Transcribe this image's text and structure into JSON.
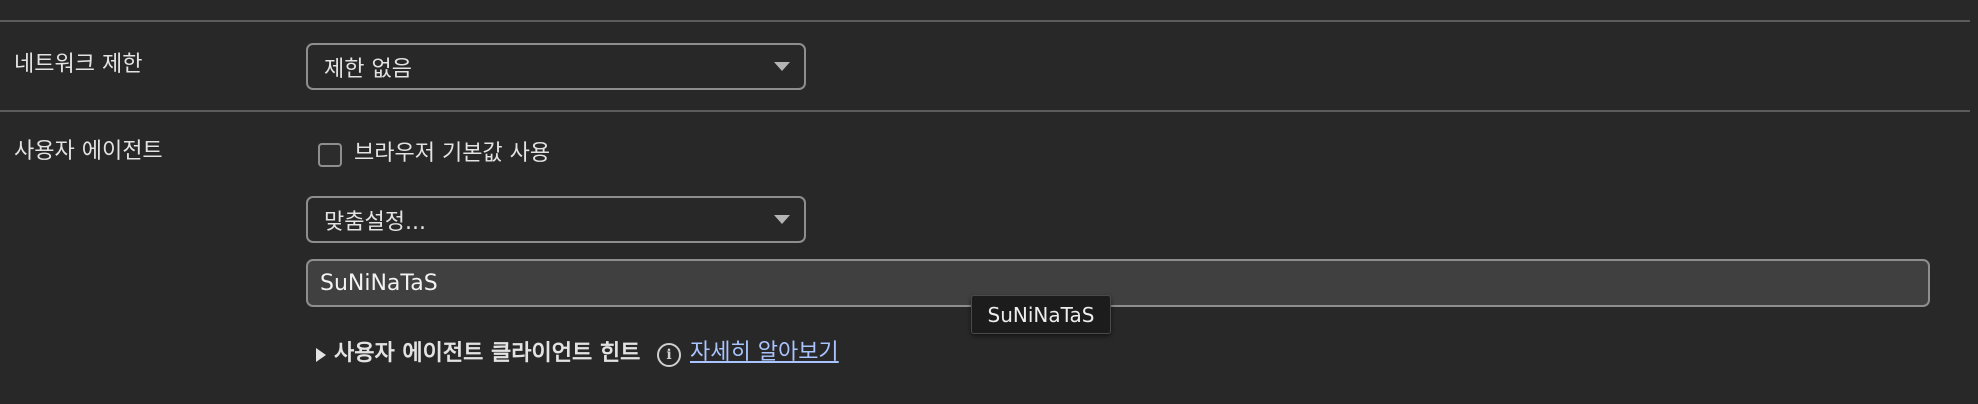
{
  "network_limit": {
    "label": "네트워크 제한",
    "selected": "제한 없음"
  },
  "user_agent": {
    "label": "사용자 에이전트",
    "use_browser_default_label": "브라우저 기본값 사용",
    "use_browser_default_checked": false,
    "preset_selected": "맞춤설정...",
    "custom_value": "SuNiNaTaS",
    "tooltip": "SuNiNaTaS",
    "client_hints_label": "사용자 에이전트 클라이언트 힌트",
    "learn_more_link": "자세히 알아보기"
  },
  "icons": {
    "dropdown": "chevron-down-icon",
    "disclosure": "triangle-right-icon",
    "info": "info-icon"
  },
  "colors": {
    "background": "#282828",
    "link": "#a9c4ff"
  }
}
